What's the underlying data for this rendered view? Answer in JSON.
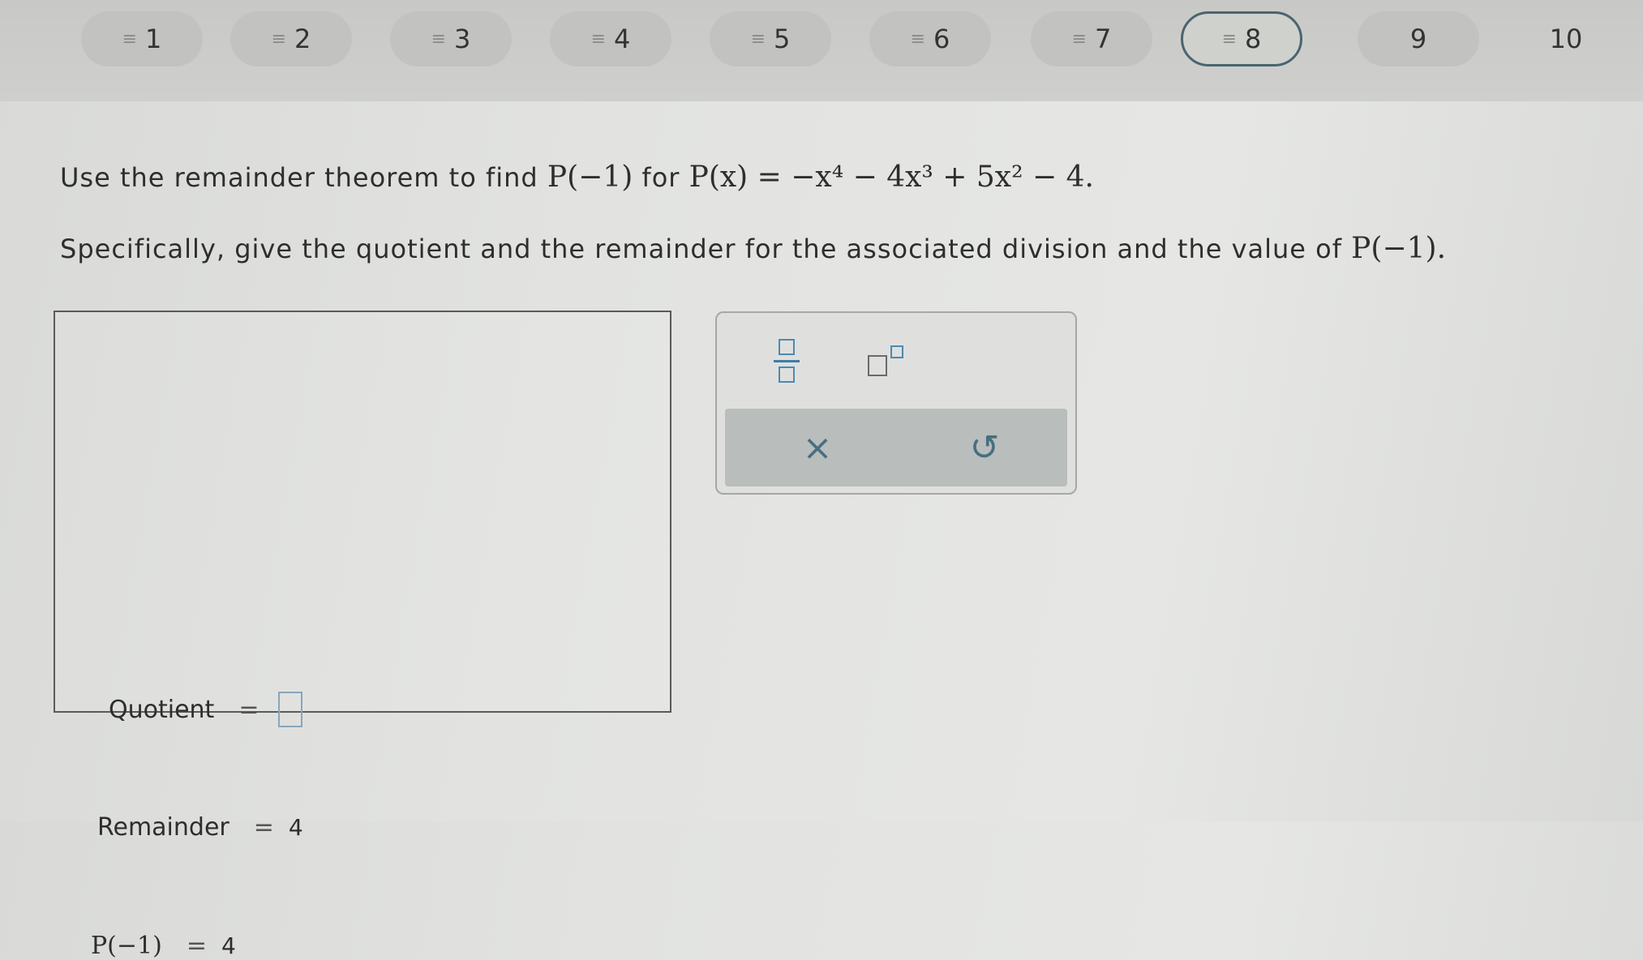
{
  "nav": {
    "items": [
      {
        "label": "1",
        "done": true,
        "current": false
      },
      {
        "label": "2",
        "done": true,
        "current": false
      },
      {
        "label": "3",
        "done": true,
        "current": false
      },
      {
        "label": "4",
        "done": true,
        "current": false
      },
      {
        "label": "5",
        "done": true,
        "current": false
      },
      {
        "label": "6",
        "done": true,
        "current": false
      },
      {
        "label": "7",
        "done": true,
        "current": false
      },
      {
        "label": "8",
        "done": true,
        "current": true
      },
      {
        "label": "9",
        "done": false,
        "current": false
      },
      {
        "label": "10",
        "done": false,
        "current": false
      }
    ],
    "done_glyph": "≡"
  },
  "question": {
    "line1_prefix": "Use the remainder theorem to find",
    "line1_for": "for",
    "line2": "Specifically, give the quotient and the remainder for the associated division and the value of"
  },
  "math": {
    "p_of_neg1": "P(−1)",
    "poly": "P(x) = −x⁴ − 4x³ + 5x² − 4."
  },
  "answer": {
    "quotient_label": "Quotient",
    "remainder_label": "Remainder",
    "remainder_value": "4",
    "p_value_label": "P(−1)",
    "p_value": "4",
    "equals": "="
  },
  "palette": {
    "clear_glyph": "×",
    "undo_glyph": "↺"
  },
  "colors": {
    "accent": "#4c8ab0",
    "current_border": "#4a6470",
    "action_icon": "#46707f"
  }
}
